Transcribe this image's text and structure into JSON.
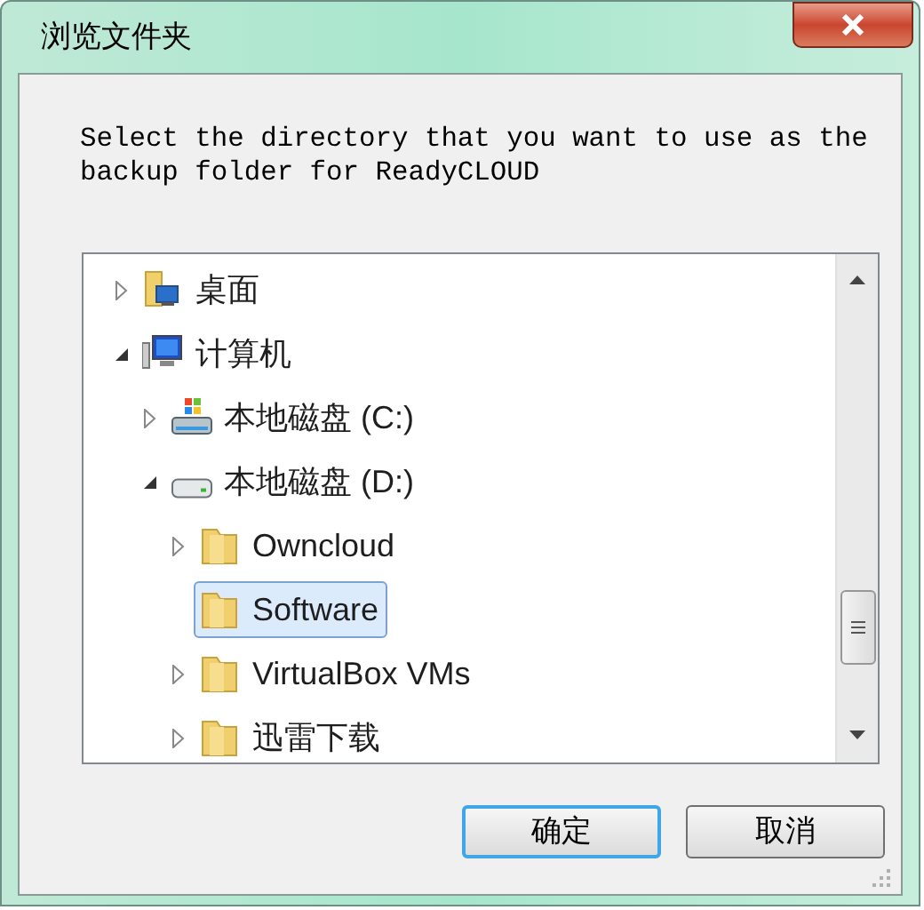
{
  "window": {
    "title": "浏览文件夹"
  },
  "description": "Select the directory that you want to use as the backup folder for ReadyCLOUD",
  "tree": [
    {
      "label": "桌面",
      "kind": "desktop",
      "expandable": true,
      "expanded": false,
      "selected": false
    },
    {
      "label": "计算机",
      "kind": "computer",
      "expandable": true,
      "expanded": true,
      "selected": false,
      "children": [
        {
          "label": "本地磁盘 (C:)",
          "kind": "system-drive",
          "expandable": true,
          "expanded": false,
          "selected": false
        },
        {
          "label": "本地磁盘 (D:)",
          "kind": "drive",
          "expandable": true,
          "expanded": true,
          "selected": false,
          "children": [
            {
              "label": "Owncloud",
              "kind": "folder",
              "expandable": true,
              "expanded": false,
              "selected": false
            },
            {
              "label": "Software",
              "kind": "folder",
              "expandable": false,
              "selected": true
            },
            {
              "label": "VirtualBox VMs",
              "kind": "folder",
              "expandable": true,
              "expanded": false,
              "selected": false
            },
            {
              "label": "迅雷下载",
              "kind": "folder",
              "expandable": true,
              "expanded": false,
              "selected": false
            }
          ]
        }
      ]
    }
  ],
  "buttons": [
    {
      "label": "确定",
      "default": true
    },
    {
      "label": "取消",
      "default": false
    }
  ]
}
